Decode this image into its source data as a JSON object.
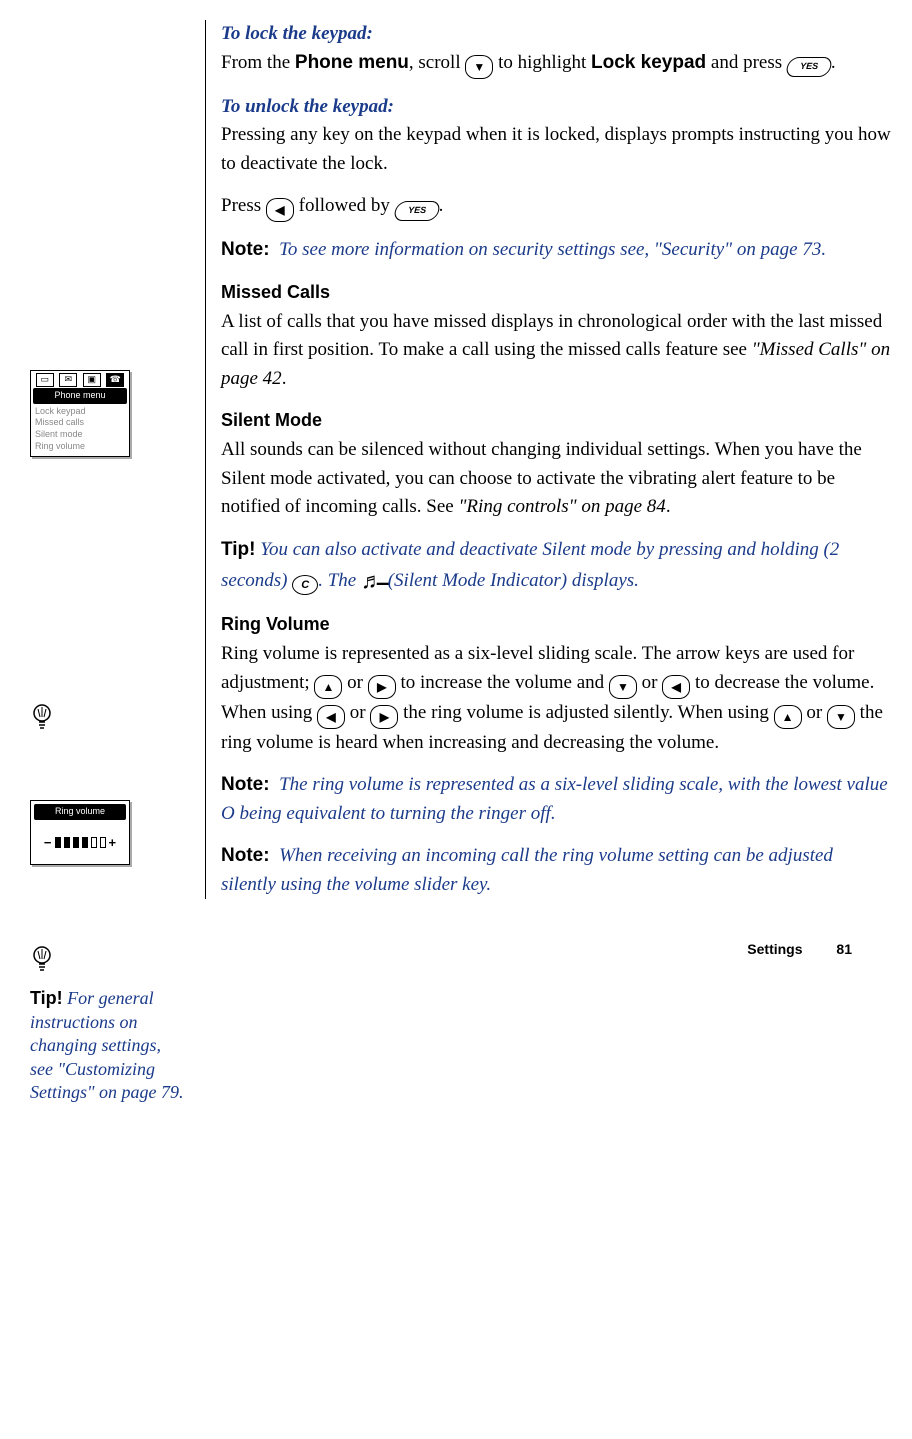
{
  "sections": {
    "lock_heading": "To lock the keypad:",
    "lock_para_a": "From the ",
    "lock_phone_menu": "Phone menu",
    "lock_para_b": ", scroll ",
    "lock_para_c": " to highlight ",
    "lock_keypad_label": "Lock keypad",
    "lock_para_d": " and press ",
    "lock_period": ".",
    "unlock_heading": "To unlock the keypad:",
    "unlock_para": "Pressing any key on the keypad when it is locked, displays prompts instructing you how to deactivate the lock.",
    "press_a": "Press ",
    "press_b": " followed by ",
    "press_period": ".",
    "note_label": "Note:",
    "note1": "To see more information on security settings see, \"Security\" on page 73.",
    "missed_head": "Missed Calls",
    "missed_para_a": "A list of calls that you have missed displays in chronological order with the last missed call in first position. To make a call using the missed calls feature see ",
    "missed_ref": "\"Missed Calls\" on page 42",
    "dot": ".",
    "silent_head": "Silent Mode",
    "silent_para_a": "All sounds can be silenced without changing individual settings. When you have the Silent mode activated, you can choose to activate the vibrating alert feature to be notified of incoming calls. See ",
    "silent_ref": "\"Ring controls\" on page 84",
    "tip_label": "Tip!",
    "tip1_a": "You can also activate and deactivate Silent mode by pressing and holding (2 seconds) ",
    "tip1_b": ". The ",
    "tip1_c": " (Silent Mode Indicator) displays.",
    "ring_head": "Ring Volume",
    "ring_para_a": "Ring volume is represented as a six-level sliding scale. The arrow keys are used for adjustment; ",
    "ring_para_b": " or ",
    "ring_para_c": " to increase the volume and ",
    "ring_para_d": " or ",
    "ring_para_e": " to decrease the volume. When using ",
    "ring_para_f": " or ",
    "ring_para_g": " the ring volume is adjusted silently. When using ",
    "ring_para_h": " or ",
    "ring_para_i": " the ring volume is heard when increasing and decreasing the volume.",
    "note2": "The ring volume is represented as a six-level sliding scale, with the lowest value O being equivalent to turning the ringer off.",
    "note3": "When receiving an incoming call the ring volume setting can be adjusted silently using the volume slider key."
  },
  "side": {
    "phone_menu_title": "Phone menu",
    "phone_items": {
      "i0": "Lock keypad",
      "i1": "Missed calls",
      "i2": "Silent mode",
      "i3": "Ring volume"
    },
    "ring_title": "Ring volume",
    "tip2_a": "For general instructions on changing settings, see \"Customizing Settings\" on page 79."
  },
  "keys": {
    "yes": "YES",
    "c": "C"
  },
  "footer": {
    "section": "Settings",
    "page": "81"
  }
}
